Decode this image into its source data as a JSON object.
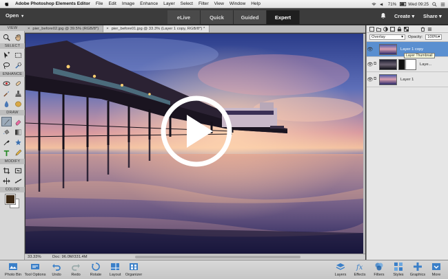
{
  "menubar": {
    "app": "Adobe Photoshop Elements Editor",
    "items": [
      "File",
      "Edit",
      "Image",
      "Enhance",
      "Layer",
      "Select",
      "Filter",
      "View",
      "Window",
      "Help"
    ],
    "battery": "71%",
    "clock": "Wed 09:25"
  },
  "topbar": {
    "open_label": "Open",
    "modes": [
      "eLive",
      "Quick",
      "Guided",
      "Expert"
    ],
    "active_mode": "Expert",
    "create_label": "Create",
    "share_label": "Share"
  },
  "toolbar": {
    "sections": [
      "VIEW",
      "SELECT",
      "ENHANCE",
      "DRAW",
      "MODIFY",
      "COLOR"
    ]
  },
  "documents": {
    "tabs": [
      "pier_before02.jpg @ 39.5% (RGB/8*)",
      "pier_before01.jpg @ 33.3% (Layer 1 copy, RGB/8*) *"
    ],
    "active_index": 1,
    "zoom": "33.33%",
    "doc_info": "Doc: 96.0M/331.4M"
  },
  "layers": {
    "blend_mode": "Overlay",
    "opacity_label": "Opacity:",
    "opacity": "100%",
    "tooltip": "Layer Thumbnail",
    "items": [
      {
        "name": "Layer 1 copy",
        "active": true
      },
      {
        "name": "Laye...",
        "active": false
      },
      {
        "name": "Layer 1",
        "active": false
      }
    ]
  },
  "bottom": {
    "left": [
      "Photo Bin",
      "Tool Options",
      "Undo",
      "Redo",
      "Rotate",
      "Layout",
      "Organizer"
    ],
    "right": [
      "Layers",
      "Effects",
      "Filters",
      "Styles",
      "Graphics",
      "More"
    ]
  },
  "colors": {
    "foreground": "#3b2814",
    "background": "#ffffff",
    "accent": "#5a8fd0"
  }
}
